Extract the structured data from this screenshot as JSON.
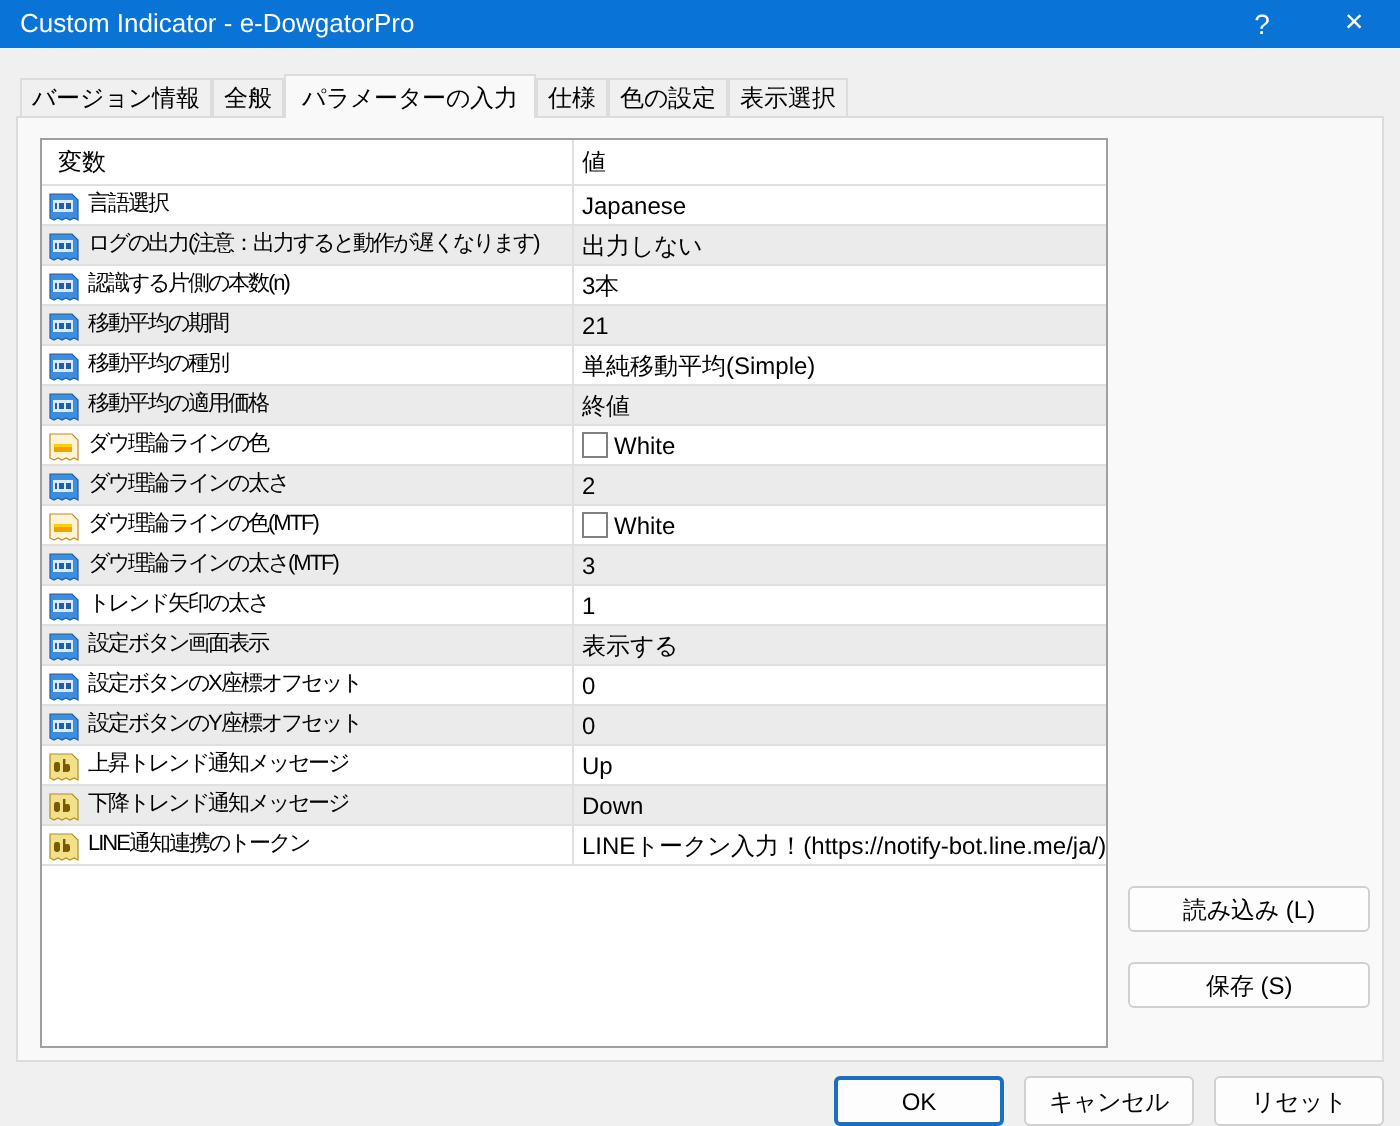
{
  "window": {
    "title": "Custom Indicator - e-DowgatorPro",
    "help": "?",
    "close": "×"
  },
  "tabs": [
    {
      "label": "バージョン情報",
      "selected": false
    },
    {
      "label": "全般",
      "selected": false
    },
    {
      "label": "パラメーターの入力",
      "selected": true
    },
    {
      "label": "仕様",
      "selected": false
    },
    {
      "label": "色の設定",
      "selected": false
    },
    {
      "label": "表示選択",
      "selected": false
    }
  ],
  "table": {
    "columns": [
      "変数",
      "値"
    ],
    "rows": [
      {
        "kind": "number",
        "name": "言語選択",
        "value": "Japanese"
      },
      {
        "kind": "number",
        "name": "ログの出力(注意：出力すると動作が遅くなります)",
        "value": "出力しない"
      },
      {
        "kind": "number",
        "name": "認識する片側の本数(n)",
        "value": "3本"
      },
      {
        "kind": "number",
        "name": "移動平均の期間",
        "value": "21"
      },
      {
        "kind": "number",
        "name": "移動平均の種別",
        "value": "単純移動平均(Simple)"
      },
      {
        "kind": "number",
        "name": "移動平均の適用価格",
        "value": "終値"
      },
      {
        "kind": "color",
        "name": "ダウ理論ラインの色",
        "value": "White",
        "color": "#ffffff"
      },
      {
        "kind": "number",
        "name": "ダウ理論ラインの太さ",
        "value": "2"
      },
      {
        "kind": "color",
        "name": "ダウ理論ラインの色(MTF)",
        "value": "White",
        "color": "#ffffff"
      },
      {
        "kind": "number",
        "name": "ダウ理論ラインの太さ(MTF)",
        "value": "3"
      },
      {
        "kind": "number",
        "name": "トレンド矢印の太さ",
        "value": "1"
      },
      {
        "kind": "number",
        "name": "設定ボタン画面表示",
        "value": "表示する"
      },
      {
        "kind": "number",
        "name": "設定ボタンのX座標オフセット",
        "value": "0"
      },
      {
        "kind": "number",
        "name": "設定ボタンのY座標オフセット",
        "value": "0"
      },
      {
        "kind": "string",
        "name": "上昇トレンド通知メッセージ",
        "value": "Up"
      },
      {
        "kind": "string",
        "name": "下降トレンド通知メッセージ",
        "value": "Down"
      },
      {
        "kind": "string",
        "name": "LINE通知連携のトークン",
        "value": "LINEトークン入力！(https://notify-bot.line.me/ja/)"
      }
    ]
  },
  "side_buttons": [
    "読み込み (L)",
    "保存 (S)"
  ],
  "buttons": [
    {
      "label": "OK",
      "default": true
    },
    {
      "label": "キャンセル",
      "default": false
    },
    {
      "label": "リセット",
      "default": false
    }
  ]
}
